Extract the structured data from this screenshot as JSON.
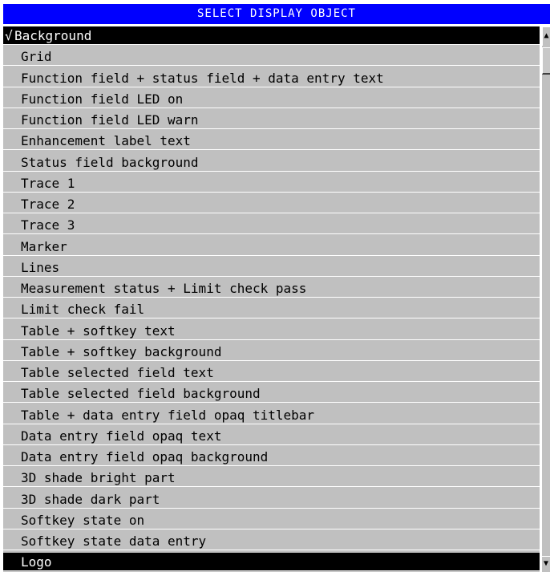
{
  "dialog": {
    "title": "SELECT DISPLAY OBJECT",
    "colors": {
      "titlebar": "#0000ff",
      "list_background": "#c0c0c0",
      "selected_background": "#000000",
      "selected_text": "#ffffff",
      "row_text": "#000000"
    }
  },
  "list": {
    "selected_index": 0,
    "check_mark": "√",
    "items": [
      "Background",
      "Grid",
      "Function field + status field + data entry text",
      "Function field LED on",
      "Function field LED warn",
      "Enhancement label text",
      "Status field background",
      "Trace 1",
      "Trace 2",
      "Trace 3",
      "Marker",
      "Lines",
      "Measurement status + Limit check pass",
      "Limit check fail",
      "Table + softkey text",
      "Table + softkey background",
      "Table selected field text",
      "Table selected field background",
      "Table + data entry field opaq titlebar",
      "Data entry field opaq text",
      "Data entry field opaq background",
      "3D shade bright part",
      "3D shade dark part",
      "Softkey state on",
      "Softkey state data entry",
      "Logo"
    ]
  },
  "scrollbar": {
    "up_glyph": "▲",
    "down_glyph": "▼",
    "position_fraction": 0.0
  }
}
